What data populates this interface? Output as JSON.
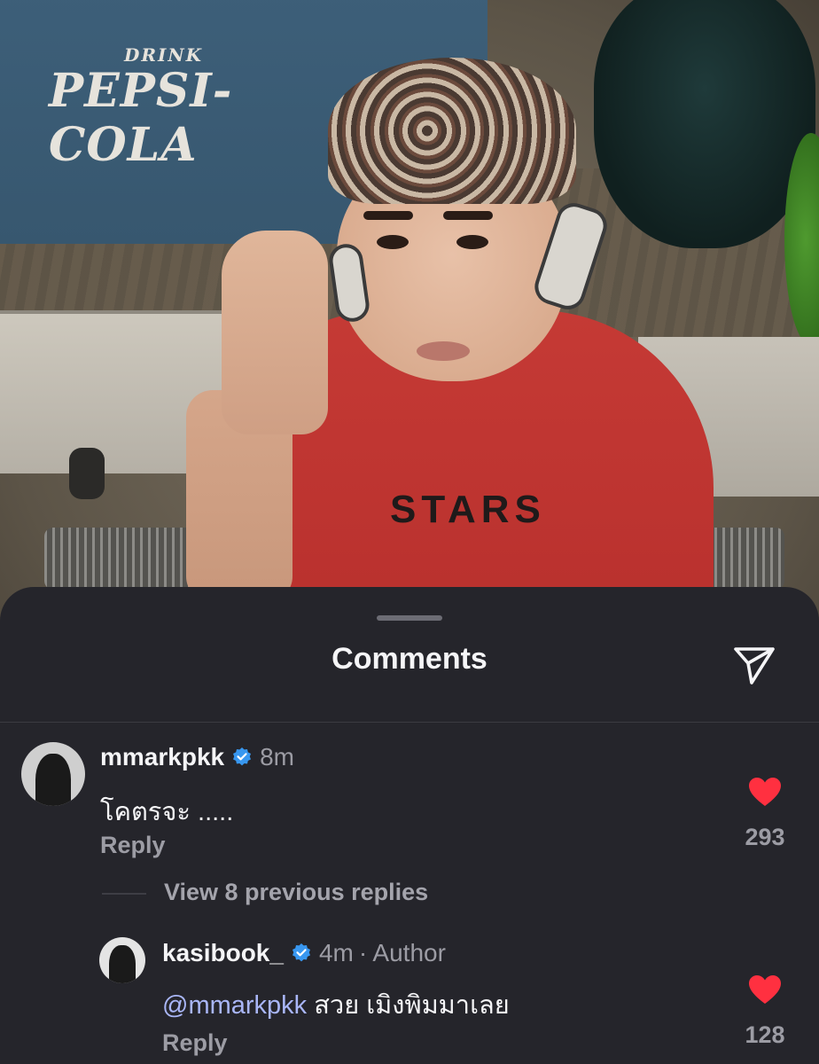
{
  "photo": {
    "logo_top": "DRINK",
    "logo_brand": "PEPSI-COLA",
    "shirt_text": "STARS"
  },
  "sheet": {
    "title": "Comments",
    "share_icon": "paper-plane-icon"
  },
  "comments": [
    {
      "username": "mmarkpkk",
      "verified": true,
      "time": "8m",
      "text": "โคตรจะ .....",
      "reply_label": "Reply",
      "likes": "293",
      "liked": true
    }
  ],
  "view_previous": "View 8 previous replies",
  "replies": [
    {
      "username": "kasibook_",
      "verified": true,
      "time": "4m",
      "author_label": "· Author",
      "mention": "@mmarkpkk",
      "text": " สวย เมิงพิมมาเลย",
      "reply_label": "Reply",
      "likes": "128",
      "liked": true
    }
  ],
  "colors": {
    "sheet_bg": "#25252b",
    "like_red": "#ff3040",
    "verified_blue": "#3897f0",
    "mention_blue": "#a9b6f7"
  }
}
